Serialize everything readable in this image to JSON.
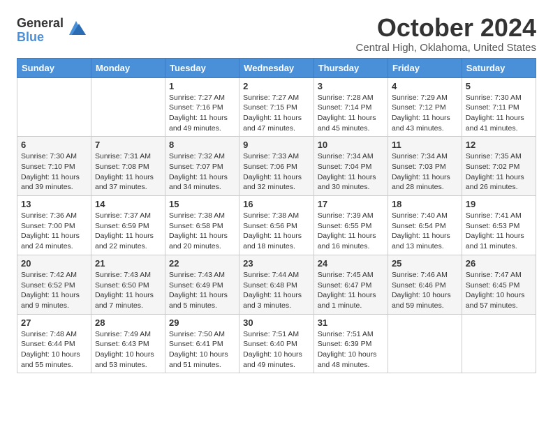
{
  "logo": {
    "general": "General",
    "blue": "Blue"
  },
  "title": "October 2024",
  "location": "Central High, Oklahoma, United States",
  "days_of_week": [
    "Sunday",
    "Monday",
    "Tuesday",
    "Wednesday",
    "Thursday",
    "Friday",
    "Saturday"
  ],
  "weeks": [
    [
      {
        "day": "",
        "info": ""
      },
      {
        "day": "",
        "info": ""
      },
      {
        "day": "1",
        "info": "Sunrise: 7:27 AM\nSunset: 7:16 PM\nDaylight: 11 hours and 49 minutes."
      },
      {
        "day": "2",
        "info": "Sunrise: 7:27 AM\nSunset: 7:15 PM\nDaylight: 11 hours and 47 minutes."
      },
      {
        "day": "3",
        "info": "Sunrise: 7:28 AM\nSunset: 7:14 PM\nDaylight: 11 hours and 45 minutes."
      },
      {
        "day": "4",
        "info": "Sunrise: 7:29 AM\nSunset: 7:12 PM\nDaylight: 11 hours and 43 minutes."
      },
      {
        "day": "5",
        "info": "Sunrise: 7:30 AM\nSunset: 7:11 PM\nDaylight: 11 hours and 41 minutes."
      }
    ],
    [
      {
        "day": "6",
        "info": "Sunrise: 7:30 AM\nSunset: 7:10 PM\nDaylight: 11 hours and 39 minutes."
      },
      {
        "day": "7",
        "info": "Sunrise: 7:31 AM\nSunset: 7:08 PM\nDaylight: 11 hours and 37 minutes."
      },
      {
        "day": "8",
        "info": "Sunrise: 7:32 AM\nSunset: 7:07 PM\nDaylight: 11 hours and 34 minutes."
      },
      {
        "day": "9",
        "info": "Sunrise: 7:33 AM\nSunset: 7:06 PM\nDaylight: 11 hours and 32 minutes."
      },
      {
        "day": "10",
        "info": "Sunrise: 7:34 AM\nSunset: 7:04 PM\nDaylight: 11 hours and 30 minutes."
      },
      {
        "day": "11",
        "info": "Sunrise: 7:34 AM\nSunset: 7:03 PM\nDaylight: 11 hours and 28 minutes."
      },
      {
        "day": "12",
        "info": "Sunrise: 7:35 AM\nSunset: 7:02 PM\nDaylight: 11 hours and 26 minutes."
      }
    ],
    [
      {
        "day": "13",
        "info": "Sunrise: 7:36 AM\nSunset: 7:00 PM\nDaylight: 11 hours and 24 minutes."
      },
      {
        "day": "14",
        "info": "Sunrise: 7:37 AM\nSunset: 6:59 PM\nDaylight: 11 hours and 22 minutes."
      },
      {
        "day": "15",
        "info": "Sunrise: 7:38 AM\nSunset: 6:58 PM\nDaylight: 11 hours and 20 minutes."
      },
      {
        "day": "16",
        "info": "Sunrise: 7:38 AM\nSunset: 6:56 PM\nDaylight: 11 hours and 18 minutes."
      },
      {
        "day": "17",
        "info": "Sunrise: 7:39 AM\nSunset: 6:55 PM\nDaylight: 11 hours and 16 minutes."
      },
      {
        "day": "18",
        "info": "Sunrise: 7:40 AM\nSunset: 6:54 PM\nDaylight: 11 hours and 13 minutes."
      },
      {
        "day": "19",
        "info": "Sunrise: 7:41 AM\nSunset: 6:53 PM\nDaylight: 11 hours and 11 minutes."
      }
    ],
    [
      {
        "day": "20",
        "info": "Sunrise: 7:42 AM\nSunset: 6:52 PM\nDaylight: 11 hours and 9 minutes."
      },
      {
        "day": "21",
        "info": "Sunrise: 7:43 AM\nSunset: 6:50 PM\nDaylight: 11 hours and 7 minutes."
      },
      {
        "day": "22",
        "info": "Sunrise: 7:43 AM\nSunset: 6:49 PM\nDaylight: 11 hours and 5 minutes."
      },
      {
        "day": "23",
        "info": "Sunrise: 7:44 AM\nSunset: 6:48 PM\nDaylight: 11 hours and 3 minutes."
      },
      {
        "day": "24",
        "info": "Sunrise: 7:45 AM\nSunset: 6:47 PM\nDaylight: 11 hours and 1 minute."
      },
      {
        "day": "25",
        "info": "Sunrise: 7:46 AM\nSunset: 6:46 PM\nDaylight: 10 hours and 59 minutes."
      },
      {
        "day": "26",
        "info": "Sunrise: 7:47 AM\nSunset: 6:45 PM\nDaylight: 10 hours and 57 minutes."
      }
    ],
    [
      {
        "day": "27",
        "info": "Sunrise: 7:48 AM\nSunset: 6:44 PM\nDaylight: 10 hours and 55 minutes."
      },
      {
        "day": "28",
        "info": "Sunrise: 7:49 AM\nSunset: 6:43 PM\nDaylight: 10 hours and 53 minutes."
      },
      {
        "day": "29",
        "info": "Sunrise: 7:50 AM\nSunset: 6:41 PM\nDaylight: 10 hours and 51 minutes."
      },
      {
        "day": "30",
        "info": "Sunrise: 7:51 AM\nSunset: 6:40 PM\nDaylight: 10 hours and 49 minutes."
      },
      {
        "day": "31",
        "info": "Sunrise: 7:51 AM\nSunset: 6:39 PM\nDaylight: 10 hours and 48 minutes."
      },
      {
        "day": "",
        "info": ""
      },
      {
        "day": "",
        "info": ""
      }
    ]
  ]
}
